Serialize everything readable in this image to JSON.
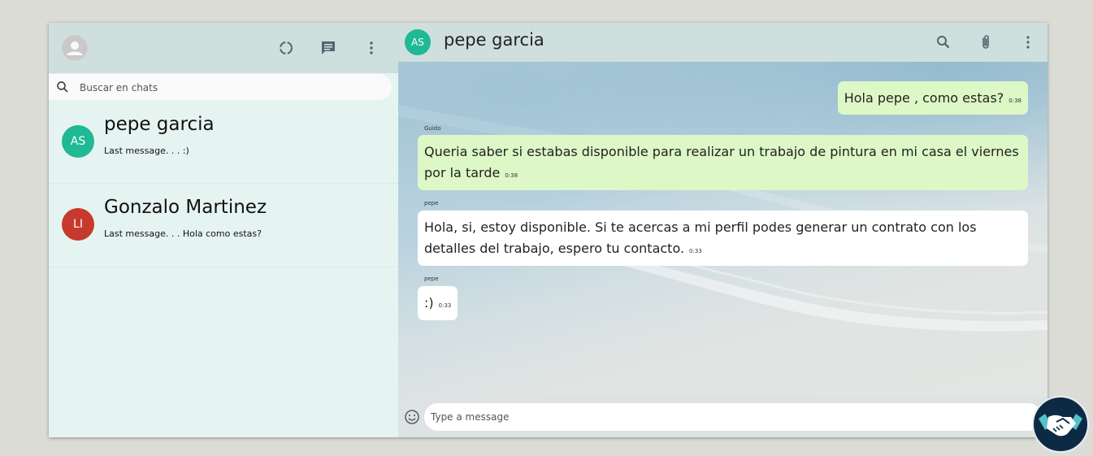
{
  "sidebar": {
    "search": {
      "placeholder": "Buscar en chats"
    },
    "chats": [
      {
        "initials": "AS",
        "name": "pepe garcia",
        "last_message": "Last message. . . :)",
        "avatar_color": "#1fb995"
      },
      {
        "initials": "LI",
        "name": "Gonzalo Martinez",
        "last_message": "Last message. . . Hola como estas?",
        "avatar_color": "#c63a2d"
      }
    ],
    "icons": {
      "profile": "avatar-icon",
      "status": "status-ring-icon",
      "new_chat": "chat-icon",
      "menu": "more-vert-icon"
    }
  },
  "chat": {
    "title": "pepe garcia",
    "avatar_initials": "AS",
    "avatar_color": "#1fb995",
    "icons": {
      "search": "search-icon",
      "attach": "paperclip-icon",
      "menu": "more-vert-icon"
    },
    "messages": [
      {
        "direction": "outgoing",
        "sender": "",
        "text": "Hola pepe , como estas?",
        "time": "0:38"
      },
      {
        "direction": "outgoing",
        "sender": "Guido",
        "text": "Queria saber si estabas disponible para realizar un trabajo de pintura en mi casa el viernes por la tarde",
        "time": "0:38"
      },
      {
        "direction": "incoming",
        "sender": "pepe",
        "text": "Hola, si, estoy disponible. Si te acercas a mi perfil podes generar un contrato con los detalles del trabajo, espero tu contacto.",
        "time": "0:33"
      },
      {
        "direction": "incoming",
        "sender": "pepe",
        "text": ":)",
        "time": "0:33"
      }
    ]
  },
  "composer": {
    "placeholder": "Type a message",
    "icon": "emoji-icon"
  },
  "colors": {
    "outgoing_bubble": "#ddf8c6",
    "incoming_bubble": "#ffffff",
    "header": "#cfdfdd",
    "sidebar": "#e6f4f1"
  },
  "badge": {
    "icon": "handshake-icon"
  }
}
